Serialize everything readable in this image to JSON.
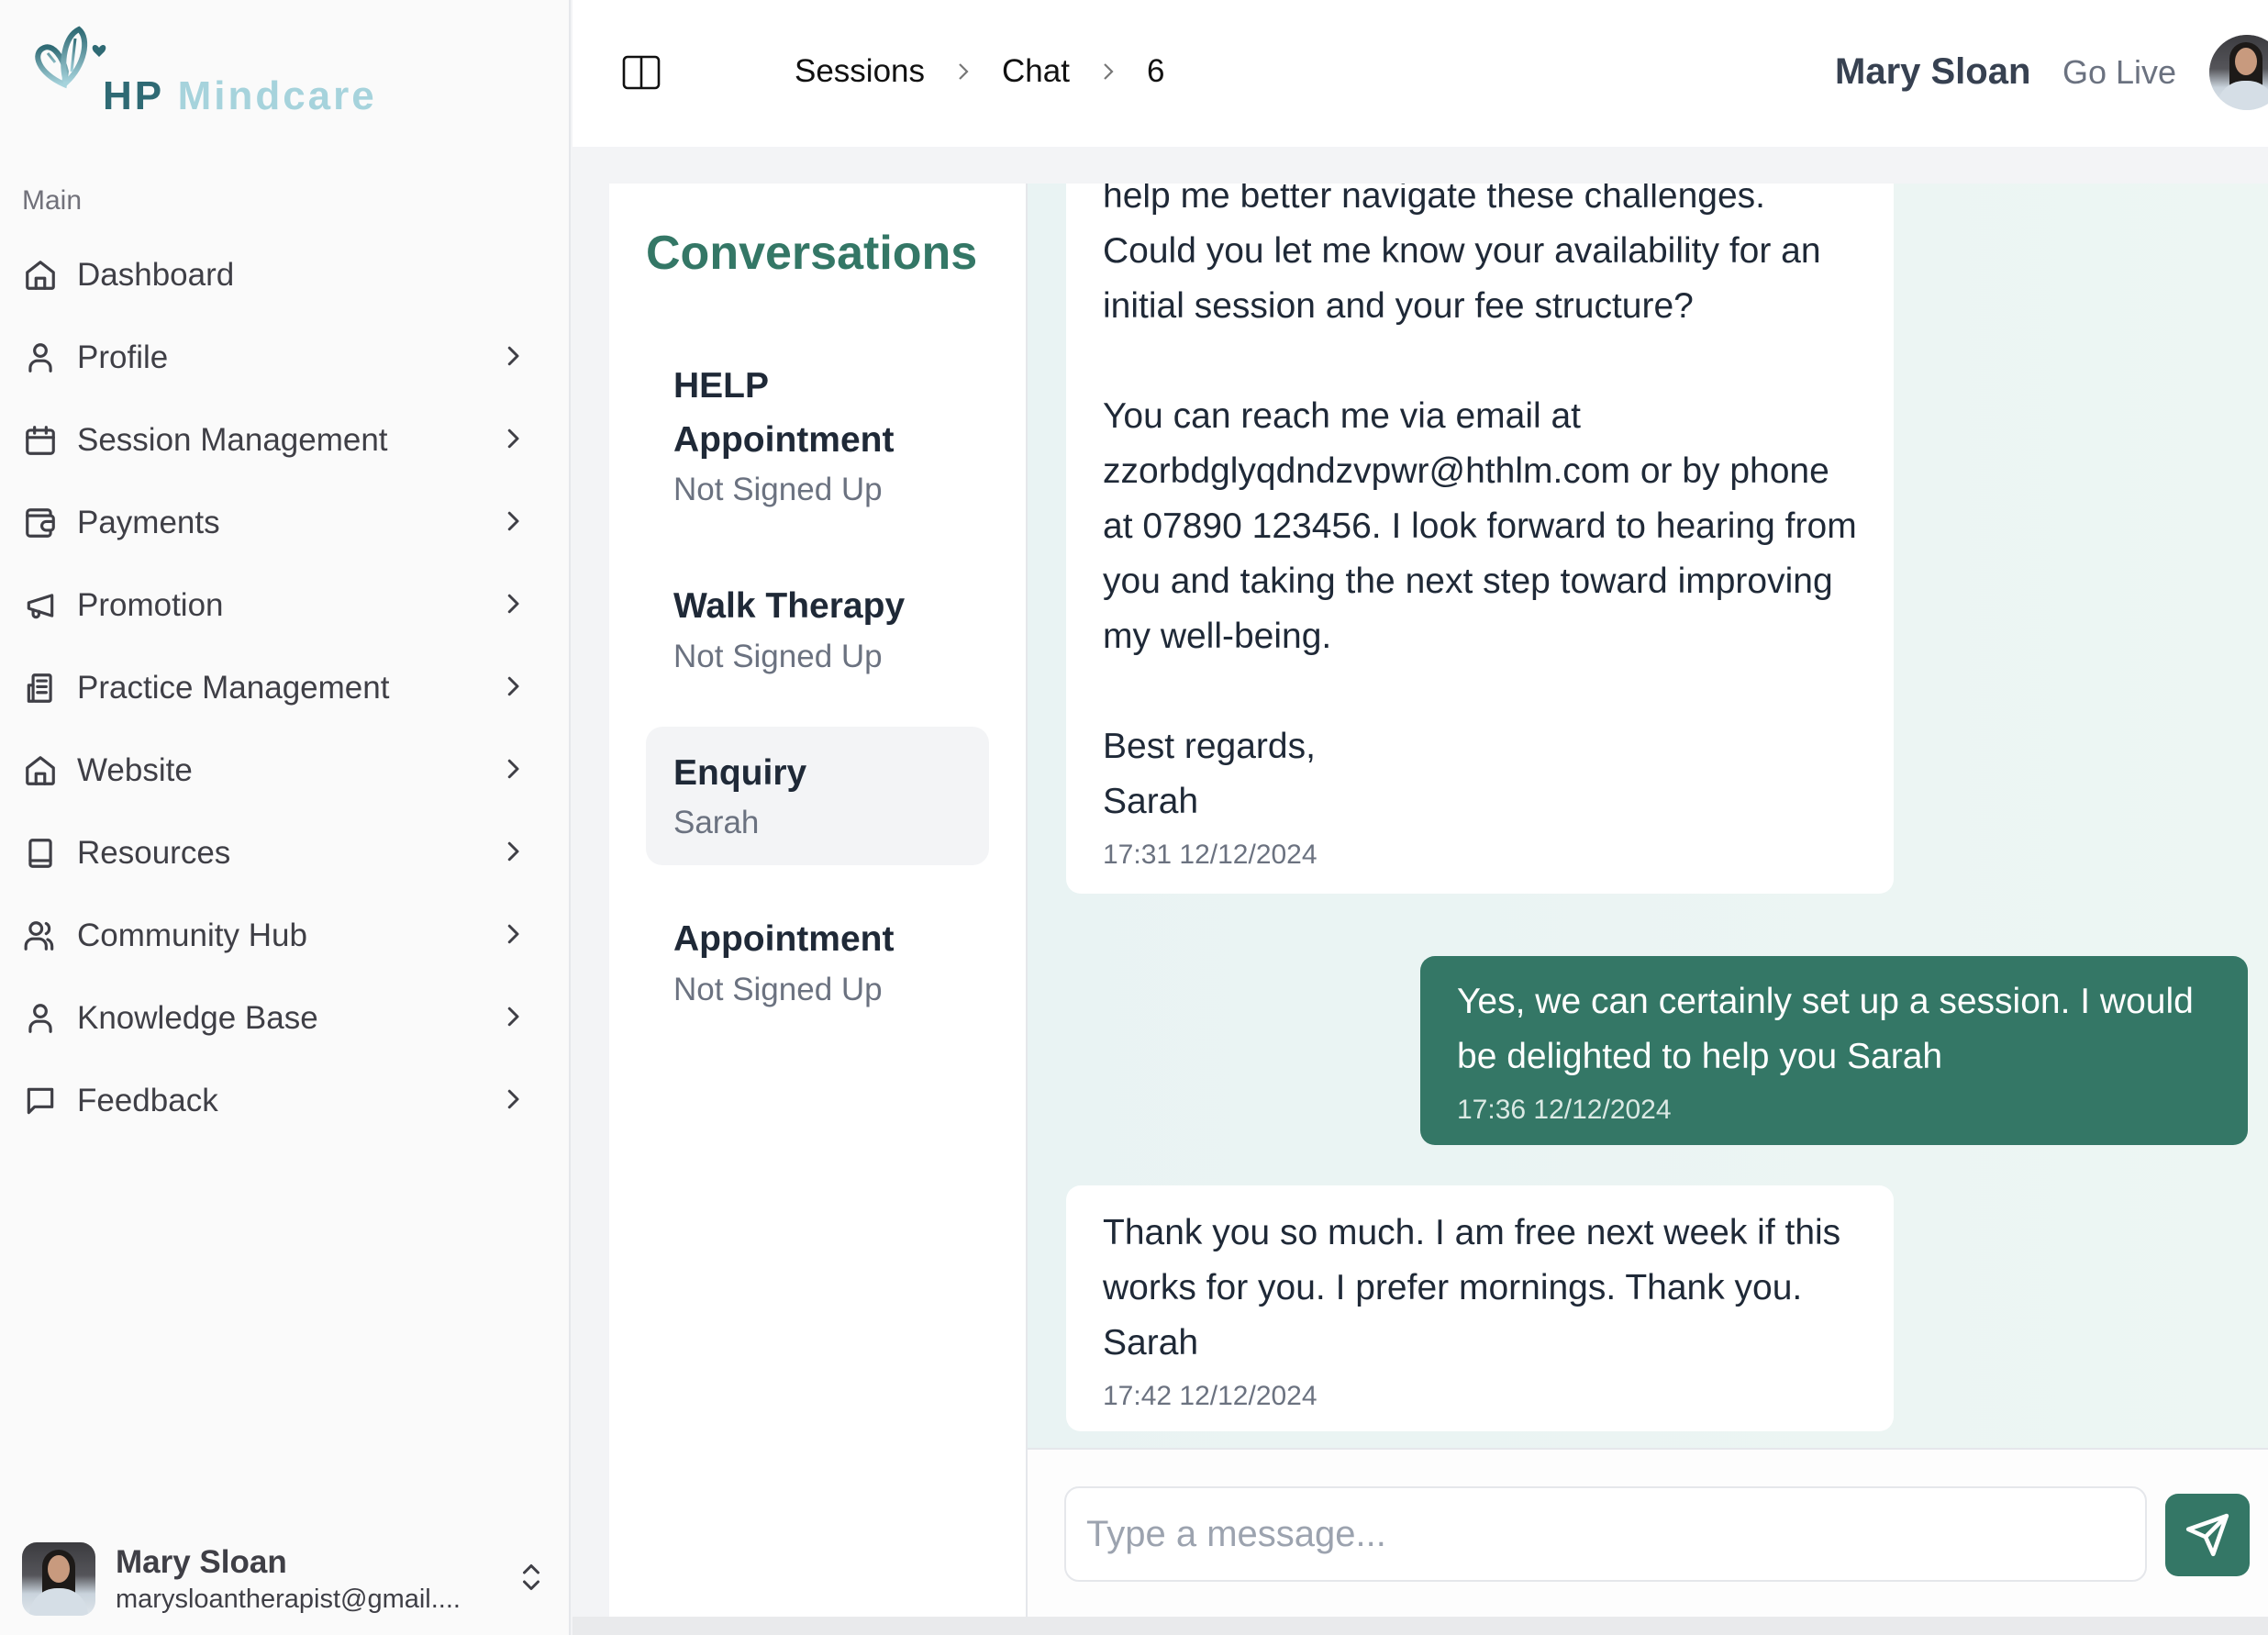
{
  "brand": {
    "name_part1": "HP",
    "name_part2": "Mindcare",
    "colors": {
      "primary": "#347766",
      "logo_dark": "#2f6a74",
      "logo_light": "#a6d3dc"
    }
  },
  "sidebar": {
    "section_label": "Main",
    "items": [
      {
        "label": "Dashboard",
        "icon": "home-icon",
        "has_chevron": false
      },
      {
        "label": "Profile",
        "icon": "user-icon",
        "has_chevron": true
      },
      {
        "label": "Session Management",
        "icon": "calendar-icon",
        "has_chevron": true
      },
      {
        "label": "Payments",
        "icon": "wallet-icon",
        "has_chevron": true
      },
      {
        "label": "Promotion",
        "icon": "megaphone-icon",
        "has_chevron": true
      },
      {
        "label": "Practice Management",
        "icon": "building-icon",
        "has_chevron": true
      },
      {
        "label": "Website",
        "icon": "home-icon",
        "has_chevron": true
      },
      {
        "label": "Resources",
        "icon": "book-icon",
        "has_chevron": true
      },
      {
        "label": "Community Hub",
        "icon": "users-icon",
        "has_chevron": true
      },
      {
        "label": "Knowledge Base",
        "icon": "user-icon",
        "has_chevron": true
      },
      {
        "label": "Feedback",
        "icon": "message-square-icon",
        "has_chevron": true
      }
    ],
    "user": {
      "name": "Mary Sloan",
      "email": "marysloantherapist@gmail...."
    }
  },
  "header": {
    "breadcrumb": [
      "Sessions",
      "Chat",
      "6"
    ],
    "user_name": "Mary Sloan",
    "go_live_label": "Go Live"
  },
  "conversations": {
    "title": "Conversations",
    "items": [
      {
        "name": "HELP Appointment",
        "sub": "Not Signed Up",
        "active": false
      },
      {
        "name": "Walk Therapy",
        "sub": "Not Signed Up",
        "active": false
      },
      {
        "name": "Enquiry",
        "sub": "Sarah",
        "active": true
      },
      {
        "name": "Appointment",
        "sub": "Not Signed Up",
        "active": false
      }
    ]
  },
  "chat": {
    "messages": [
      {
        "direction": "in",
        "text": "help me better navigate these challenges. Could you let me know your availability for an initial session and your fee structure?\n\nYou can reach me via email at zzorbdglyqdndzvpwr@hthlm.com or by phone at 07890 123456. I look forward to hearing from you and taking the next step toward improving my well-being.\n\nBest regards,\nSarah",
        "time": "17:31 12/12/2024"
      },
      {
        "direction": "out",
        "text": "Yes, we can certainly set up a session. I would be delighted to help you Sarah",
        "time": "17:36 12/12/2024"
      },
      {
        "direction": "in",
        "text": "Thank you so much. I am free next week if this works for you. I prefer mornings. Thank you. Sarah",
        "time": "17:42 12/12/2024"
      }
    ],
    "input_placeholder": "Type a message...",
    "input_value": ""
  }
}
